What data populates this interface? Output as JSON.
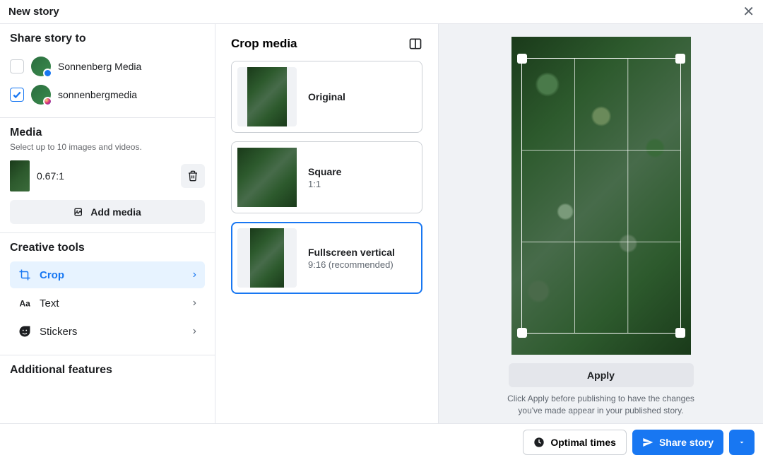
{
  "header": {
    "title": "New story"
  },
  "share": {
    "heading": "Share story to",
    "targets": [
      {
        "name": "Sonnenberg Media",
        "checked": false,
        "platform": "fb"
      },
      {
        "name": "sonnenbergmedia",
        "checked": true,
        "platform": "ig"
      }
    ]
  },
  "media": {
    "heading": "Media",
    "subtext": "Select up to 10 images and videos.",
    "item_ratio": "0.67:1",
    "add_label": "Add media"
  },
  "tools": {
    "heading": "Creative tools",
    "items": [
      {
        "label": "Crop",
        "icon": "crop-icon",
        "selected": true
      },
      {
        "label": "Text",
        "icon": "text-icon",
        "selected": false
      },
      {
        "label": "Stickers",
        "icon": "sticker-icon",
        "selected": false
      }
    ]
  },
  "additional": {
    "heading": "Additional features"
  },
  "crop": {
    "heading": "Crop media",
    "options": [
      {
        "title": "Original",
        "sub": "",
        "shape": "orig",
        "selected": false
      },
      {
        "title": "Square",
        "sub": "1:1",
        "shape": "sq",
        "selected": false
      },
      {
        "title": "Fullscreen vertical",
        "sub": "9:16 (recommended)",
        "shape": "fv",
        "selected": true
      }
    ]
  },
  "preview": {
    "apply_label": "Apply",
    "note": "Click Apply before publishing to have the changes you've made appear in your published story."
  },
  "footer": {
    "optimal": "Optimal times",
    "share": "Share story"
  }
}
